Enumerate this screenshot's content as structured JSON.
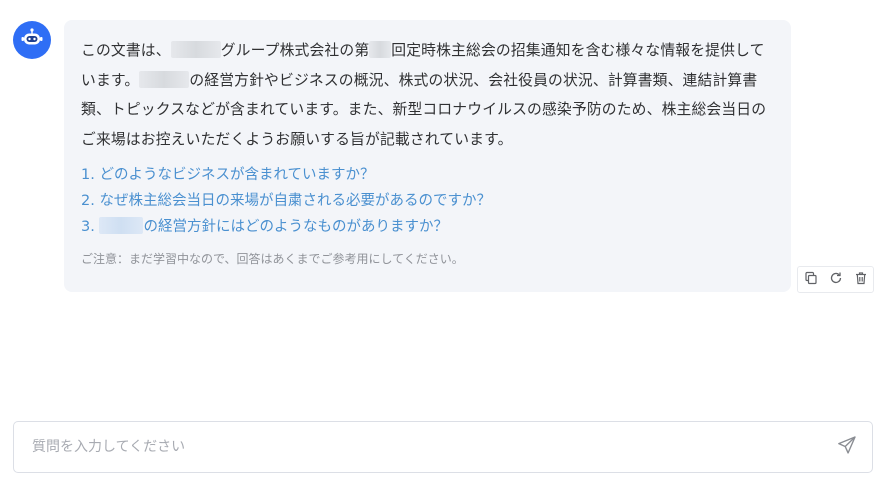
{
  "assistant": {
    "avatar_icon": "robot-icon",
    "avatar_color": "#2f6ef5"
  },
  "message": {
    "summary": {
      "part1": "この文書は、",
      "part2": "グループ株式会社の第",
      "part3": "回定時株主総会の招集通知を含む様々な情報を提供しています。",
      "part4": "の経営方針やビジネスの概況、株式の状況、会社役員の状況、計算書類、連結計算書類、トピックスなどが含まれています。また、新型コロナウイルスの感染予防のため、株主総会当日のご来場はお控えいただくようお願いする旨が記載されています。"
    },
    "questions": [
      {
        "text": "1. どのようなビジネスが含まれていますか？"
      },
      {
        "text": "2. なぜ株主総会当日の来場が自粛される必要があるのですか？"
      },
      {
        "number": "3.",
        "text_after": "の経営方針にはどのようなものがありますか？"
      }
    ],
    "notice": "ご注意：まだ学習中なので、回答はあくまでご参考用にしてください。",
    "link_color": "#4a90d0"
  },
  "actions": {
    "copy_icon": "copy-icon",
    "regenerate_icon": "refresh-icon",
    "delete_icon": "trash-icon"
  },
  "composer": {
    "placeholder": "質問を入力してください",
    "value": "",
    "send_icon": "send-icon"
  }
}
